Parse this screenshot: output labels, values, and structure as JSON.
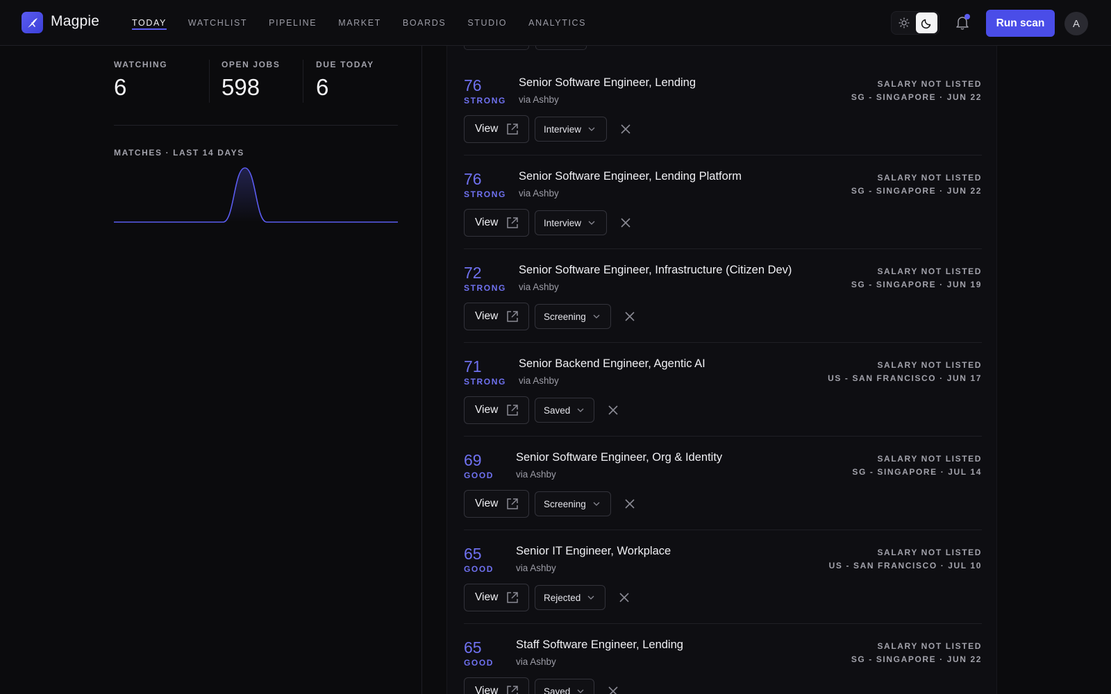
{
  "app": {
    "name": "Magpie"
  },
  "nav": [
    {
      "label": "TODAY",
      "active": true
    },
    {
      "label": "WATCHLIST"
    },
    {
      "label": "PIPELINE"
    },
    {
      "label": "MARKET"
    },
    {
      "label": "BOARDS"
    },
    {
      "label": "STUDIO"
    },
    {
      "label": "ANALYTICS"
    }
  ],
  "header": {
    "run_label": "Run scan",
    "avatar_initial": "A",
    "theme": "dark",
    "has_notification": true
  },
  "stats": [
    {
      "label": "WATCHING",
      "value": "6"
    },
    {
      "label": "OPEN JOBS",
      "value": "598"
    },
    {
      "label": "DUE TODAY",
      "value": "6"
    }
  ],
  "chart_title": "MATCHES · LAST 14 DAYS",
  "chart_data": {
    "type": "area",
    "x": [
      1,
      2,
      3,
      4,
      5,
      6,
      7,
      8,
      9,
      10,
      11,
      12,
      13,
      14
    ],
    "values": [
      0,
      0,
      0,
      0,
      0,
      0,
      8,
      0,
      0,
      0,
      0,
      0,
      0,
      0
    ],
    "ylim": [
      0,
      8
    ],
    "color": "#5b5cf0"
  },
  "jobs": [
    {
      "score": "76",
      "tier": "STRONG",
      "title": "Senior Software Engineer, Lending",
      "via": "via Ashby",
      "salary": "SALARY NOT LISTED",
      "meta": "SG - SINGAPORE · JUN 22",
      "view": "View",
      "status": "Interview"
    },
    {
      "score": "76",
      "tier": "STRONG",
      "title": "Senior Software Engineer, Lending Platform",
      "via": "via Ashby",
      "salary": "SALARY NOT LISTED",
      "meta": "SG - SINGAPORE · JUN 22",
      "view": "View",
      "status": "Interview"
    },
    {
      "score": "72",
      "tier": "STRONG",
      "title": "Senior Software Engineer, Infrastructure (Citizen Dev)",
      "via": "via Ashby",
      "salary": "SALARY NOT LISTED",
      "meta": "SG - SINGAPORE · JUN 19",
      "view": "View",
      "status": "Screening"
    },
    {
      "score": "71",
      "tier": "STRONG",
      "title": "Senior Backend Engineer, Agentic AI",
      "via": "via Ashby",
      "salary": "SALARY NOT LISTED",
      "meta": "US - SAN FRANCISCO · JUN 17",
      "view": "View",
      "status": "Saved"
    },
    {
      "score": "69",
      "tier": "GOOD",
      "title": "Senior Software Engineer, Org & Identity",
      "via": "via Ashby",
      "salary": "SALARY NOT LISTED",
      "meta": "SG - SINGAPORE · JUL 14",
      "view": "View",
      "status": "Screening"
    },
    {
      "score": "65",
      "tier": "GOOD",
      "title": "Senior IT Engineer, Workplace",
      "via": "via Ashby",
      "salary": "SALARY NOT LISTED",
      "meta": "US - SAN FRANCISCO · JUL 10",
      "view": "View",
      "status": "Rejected"
    },
    {
      "score": "65",
      "tier": "GOOD",
      "title": "Staff Software Engineer, Lending",
      "via": "via Ashby",
      "salary": "SALARY NOT LISTED",
      "meta": "SG - SINGAPORE · JUN 22",
      "view": "View",
      "status": "Saved"
    }
  ]
}
